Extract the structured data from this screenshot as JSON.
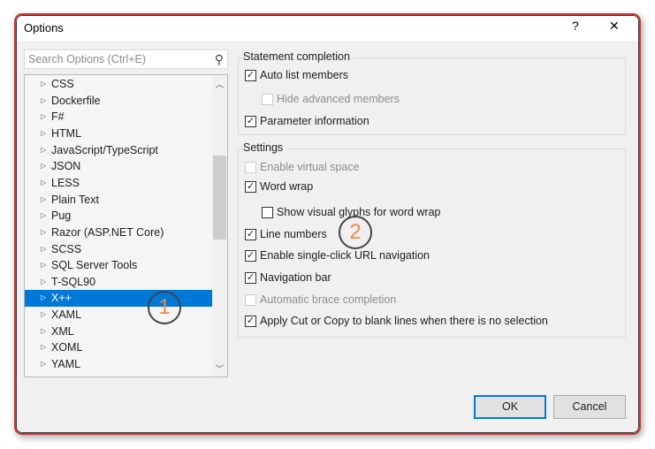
{
  "window": {
    "title": "Options",
    "help": "?",
    "close": "✕"
  },
  "search": {
    "placeholder": "Search Options (Ctrl+E)",
    "icon": "search-icon"
  },
  "tree": {
    "items": [
      "CSS",
      "Dockerfile",
      "F#",
      "HTML",
      "JavaScript/TypeScript",
      "JSON",
      "LESS",
      "Plain Text",
      "Pug",
      "Razor (ASP.NET Core)",
      "SCSS",
      "SQL Server Tools",
      "T-SQL90",
      "X++",
      "XAML",
      "XML",
      "XOML",
      "YAML"
    ],
    "selected": "X++"
  },
  "statement_completion": {
    "title": "Statement completion",
    "options": [
      {
        "label": "Auto list members",
        "checked": true,
        "enabled": true
      },
      {
        "label": "Hide advanced members",
        "checked": false,
        "enabled": false
      },
      {
        "label": "Parameter information",
        "checked": true,
        "enabled": true
      }
    ]
  },
  "settings": {
    "title": "Settings",
    "options": [
      {
        "label": "Enable virtual space",
        "checked": false,
        "enabled": false
      },
      {
        "label": "Word wrap",
        "checked": true,
        "enabled": true
      },
      {
        "label": "Show visual glyphs for word wrap",
        "checked": false,
        "enabled": true
      },
      {
        "label": "Line numbers",
        "checked": true,
        "enabled": true
      },
      {
        "label": "Enable single-click URL navigation",
        "checked": true,
        "enabled": true
      },
      {
        "label": "Navigation bar",
        "checked": true,
        "enabled": true
      },
      {
        "label": "Automatic brace completion",
        "checked": false,
        "enabled": false
      },
      {
        "label": "Apply Cut or Copy to blank lines when there is no selection",
        "checked": true,
        "enabled": true
      }
    ]
  },
  "buttons": {
    "ok": "OK",
    "cancel": "Cancel"
  },
  "annotations": [
    "1",
    "2"
  ],
  "colors": {
    "selection": "#0078d7",
    "annotation": "#f08a4b",
    "frame": "#c9393b"
  }
}
